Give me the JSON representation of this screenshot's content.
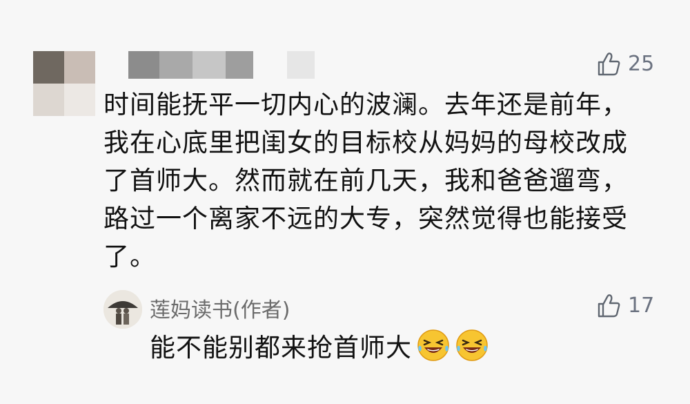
{
  "comment": {
    "like_count": "25",
    "text": "时间能抚平一切内心的波澜。去年还是前年，我在心底里把闺女的目标校从妈妈的母校改成了首师大。然而就在前几天，我和爸爸遛弯，路过一个离家不远的大专，突然觉得也能接受了。"
  },
  "reply": {
    "author": "莲妈读书(作者)",
    "like_count": "17",
    "text": "能不能别都来抢首师大",
    "emojis": [
      "laughing-tears-emoji",
      "laughing-tears-emoji"
    ]
  },
  "icons": {
    "like": "thumbs-up-outline-icon"
  },
  "colors": {
    "background": "#f7f7f7",
    "text": "#111111",
    "muted": "#6b6b6b"
  }
}
